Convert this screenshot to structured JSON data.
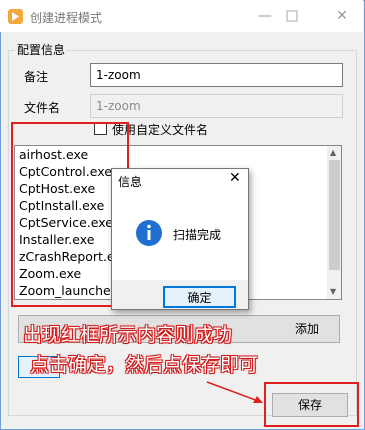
{
  "window": {
    "title": "创建进程模式",
    "minimize_icon": "minimize-icon",
    "maximize_icon": "maximize-icon",
    "close_icon": "close-icon"
  },
  "group": {
    "label": "配置信息"
  },
  "form": {
    "remark_label": "备注",
    "remark_value": "1-zoom",
    "filename_label": "文件名",
    "filename_value": "1-zoom",
    "checkbox_label": "使用自定义文件名",
    "checkbox_checked": false
  },
  "process_list": [
    "airhost.exe",
    "CptControl.exe",
    "CptHost.exe",
    "CptInstall.exe",
    "CptService.exe",
    "Installer.exe",
    "zCrashReport.exe",
    "Zoom.exe",
    "Zoom_launcher.exe"
  ],
  "buttons": {
    "add_label": "添加",
    "save_label": "保存"
  },
  "dialog": {
    "title": "信息",
    "message": "扫描完成",
    "ok_label": "确定",
    "info_icon": "info-icon",
    "close_icon": "close-icon"
  },
  "annotation": {
    "line1": "出现红框所示内容则成功",
    "line2": "点击确定，然后点保存即可",
    "color": "#e02020"
  }
}
